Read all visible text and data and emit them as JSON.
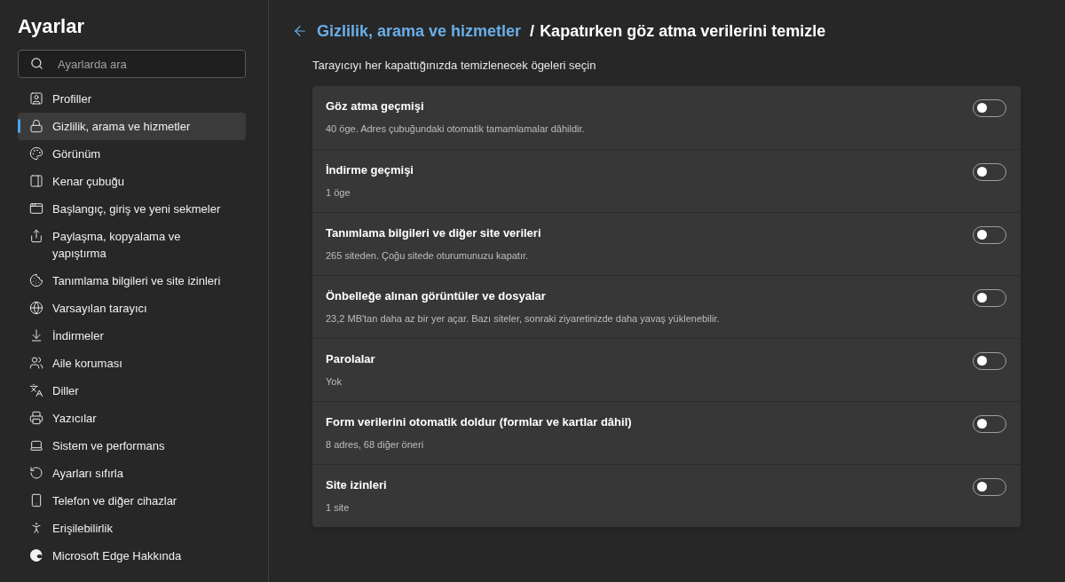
{
  "sidebar": {
    "title": "Ayarlar",
    "search": {
      "placeholder": "Ayarlarda ara"
    },
    "items": [
      {
        "label": "Profiller",
        "selected": false
      },
      {
        "label": "Gizlilik, arama ve hizmetler",
        "selected": true
      },
      {
        "label": "Görünüm",
        "selected": false
      },
      {
        "label": "Kenar çubuğu",
        "selected": false
      },
      {
        "label": "Başlangıç, giriş ve yeni sekmeler",
        "selected": false
      },
      {
        "label": "Paylaşma, kopyalama ve yapıştırma",
        "selected": false
      },
      {
        "label": "Tanımlama bilgileri ve site izinleri",
        "selected": false
      },
      {
        "label": "Varsayılan tarayıcı",
        "selected": false
      },
      {
        "label": "İndirmeler",
        "selected": false
      },
      {
        "label": "Aile koruması",
        "selected": false
      },
      {
        "label": "Diller",
        "selected": false
      },
      {
        "label": "Yazıcılar",
        "selected": false
      },
      {
        "label": "Sistem ve performans",
        "selected": false
      },
      {
        "label": "Ayarları sıfırla",
        "selected": false
      },
      {
        "label": "Telefon ve diğer cihazlar",
        "selected": false
      },
      {
        "label": "Erişilebilirlik",
        "selected": false
      },
      {
        "label": "Microsoft Edge Hakkında",
        "selected": false
      }
    ]
  },
  "header": {
    "breadcrumb_link": "Gizlilik, arama ve hizmetler",
    "separator": "/",
    "title": "Kapatırken göz atma verilerini temizle"
  },
  "subtitle": "Tarayıcıyı her kapattığınızda temizlenecek ögeleri seçin",
  "options": [
    {
      "title": "Göz atma geçmişi",
      "description": "40 öge. Adres çubuğundaki otomatik tamamlamalar dâhildir.",
      "on": false
    },
    {
      "title": "İndirme geçmişi",
      "description": "1 öge",
      "on": false
    },
    {
      "title": "Tanımlama bilgileri ve diğer site verileri",
      "description": "265 siteden. Çoğu sitede oturumunuzu kapatır.",
      "on": false
    },
    {
      "title": "Önbelleğe alınan görüntüler ve dosyalar",
      "description": "23,2 MB'tan daha az bir yer açar. Bazı siteler, sonraki ziyaretinizde daha yavaş yüklenebilir.",
      "on": false
    },
    {
      "title": "Parolalar",
      "description": "Yok",
      "on": false
    },
    {
      "title": "Form verilerini otomatik doldur (formlar ve kartlar dâhil)",
      "description": "8 adres, 68 diğer öneri",
      "on": false
    },
    {
      "title": "Site izinleri",
      "description": "1 site",
      "on": false
    }
  ]
}
